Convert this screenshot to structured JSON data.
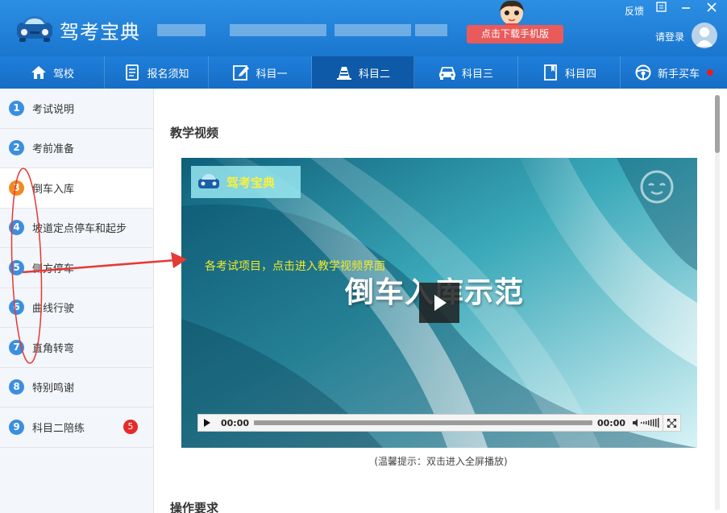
{
  "titlebar": {
    "app_title": "驾考宝典",
    "download_label": "点击下载手机版",
    "feedback_label": "反馈",
    "login_label": "请登录",
    "icons": [
      "car-logo-icon",
      "mascot-icon",
      "skin-icon",
      "minimize-icon",
      "close-icon",
      "avatar-icon"
    ]
  },
  "nav": {
    "tabs": [
      {
        "label": "驾校",
        "icon": "school-icon"
      },
      {
        "label": "报名须知",
        "icon": "document-icon"
      },
      {
        "label": "科目一",
        "icon": "edit-icon"
      },
      {
        "label": "科目二",
        "icon": "cone-icon",
        "active": true
      },
      {
        "label": "科目三",
        "icon": "car-icon"
      },
      {
        "label": "科目四",
        "icon": "book-icon"
      },
      {
        "label": "新手买车",
        "icon": "steering-wheel-icon",
        "dot": true
      }
    ]
  },
  "sidebar": {
    "items": [
      {
        "num": "1",
        "label": "考试说明"
      },
      {
        "num": "2",
        "label": "考前准备"
      },
      {
        "num": "3",
        "label": "倒车入库",
        "active": true
      },
      {
        "num": "4",
        "label": "坡道定点停车和起步"
      },
      {
        "num": "5",
        "label": "侧方停车"
      },
      {
        "num": "6",
        "label": "曲线行驶"
      },
      {
        "num": "7",
        "label": "直角转弯"
      },
      {
        "num": "8",
        "label": "特别鸣谢"
      },
      {
        "num": "9",
        "label": "科目二陪练",
        "badge": "5"
      }
    ]
  },
  "content": {
    "section1_title": "教学视频",
    "section2_title": "操作要求",
    "video": {
      "logo_text": "驾考宝典",
      "title": "倒车入库示范",
      "current_time": "00:00",
      "duration": "00:00",
      "progress": 0
    },
    "hint": "(温馨提示：双击进入全屏播放)"
  },
  "annotation": {
    "text": "各考试项目，点击进入教学视频界面",
    "color": "#e53935"
  },
  "colors": {
    "title_bar": "#2c8fe3",
    "nav_bar": "#1f7fda",
    "nav_active": "#0e5aa8",
    "sidebar_bg": "#f3f6fa",
    "number_badge": "#3b8ee0",
    "active_number": "#f08a22",
    "download_button": "#e95b5b"
  }
}
